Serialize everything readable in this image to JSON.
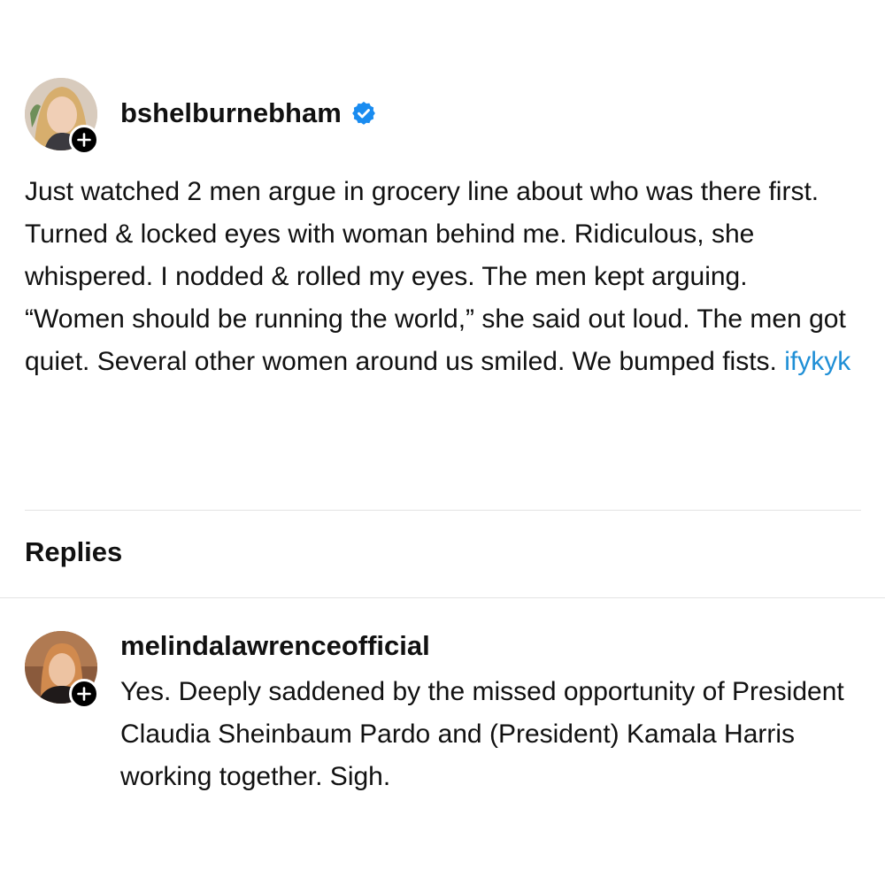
{
  "post": {
    "username": "bshelburnebham",
    "verified": true,
    "body": "Just watched 2 men argue in grocery line about who was there first. Turned & locked eyes with woman behind me. Ridiculous, she whispered. I nodded & rolled my eyes. The men kept arguing. “Women should be running the world,” she said out loud. The men got quiet. Several other women around us smiled. We bumped fists.",
    "tag": "ifykyk"
  },
  "replies": {
    "title": "Replies",
    "items": [
      {
        "username": "melindalawrenceofficial",
        "body": "Yes. Deeply saddened by the missed opportunity of President Claudia Sheinbaum Pardo and (President) Kamala Harris working together. Sigh."
      }
    ]
  },
  "icons": {
    "verified": "verified-badge-icon",
    "follow": "plus-icon"
  },
  "colors": {
    "background": "#ffffff",
    "text": "#111111",
    "hashtag": "#1f8fd6",
    "verified": "#1a8cf0",
    "divider": "#e3e3e3"
  }
}
